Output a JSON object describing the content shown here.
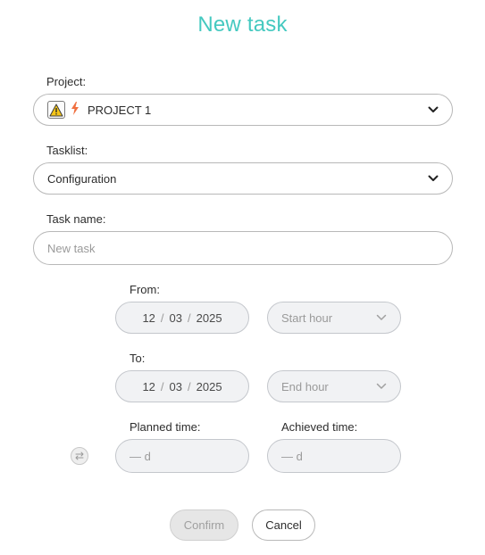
{
  "title": "New task",
  "project": {
    "label": "Project:",
    "value": "PROJECT 1",
    "icons": [
      "warning-icon",
      "lightning-icon"
    ]
  },
  "tasklist": {
    "label": "Tasklist:",
    "value": "Configuration"
  },
  "task_name": {
    "label": "Task name:",
    "value": "",
    "placeholder": "New task"
  },
  "from": {
    "label": "From:",
    "day": "12",
    "month": "03",
    "year": "2025",
    "separator": "/",
    "hour_placeholder": "Start hour"
  },
  "to": {
    "label": "To:",
    "day": "12",
    "month": "03",
    "year": "2025",
    "separator": "/",
    "hour_placeholder": "End hour"
  },
  "planned_time": {
    "label": "Planned time:",
    "value": "— d"
  },
  "achieved_time": {
    "label": "Achieved time:",
    "value": "— d"
  },
  "buttons": {
    "confirm": "Confirm",
    "cancel": "Cancel"
  },
  "colors": {
    "accent": "#45c9c0",
    "lightning": "#f07040",
    "warning": "#f5c518"
  }
}
